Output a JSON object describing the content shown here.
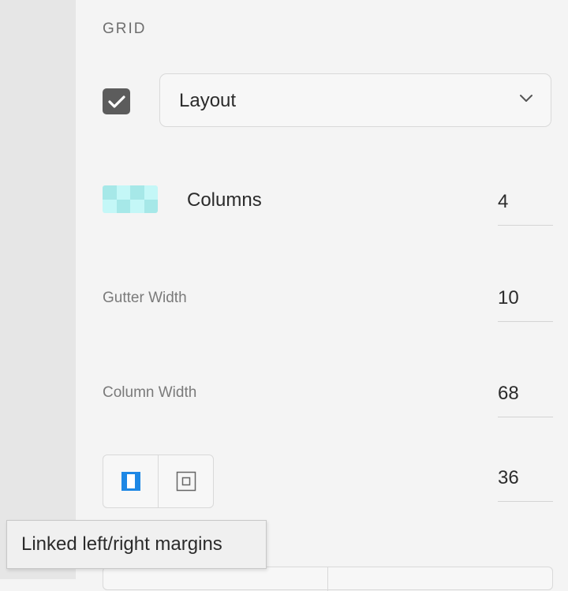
{
  "grid_section": {
    "title": "GRID",
    "layout_checkbox": {
      "checked": true
    },
    "layout_dropdown": {
      "selected": "Layout"
    },
    "columns": {
      "label": "Columns",
      "value": "4"
    },
    "gutter_width": {
      "label": "Gutter Width",
      "value": "10"
    },
    "column_width": {
      "label": "Column Width",
      "value": "68"
    },
    "margins": {
      "value": "36",
      "active_mode": "linked"
    }
  },
  "tooltip": {
    "text": "Linked left/right margins"
  },
  "colors": {
    "accent": "#1e88e5",
    "checkbox_fill": "#5c5c5c",
    "grid_swatch_light": "#c4f7f7",
    "grid_swatch_dark": "#a6e8e8"
  },
  "icons": {
    "checkbox": "checkmark-icon",
    "dropdown": "chevron-down-icon",
    "linked_margins": "linked-margins-icon",
    "unlinked_margins": "unlinked-margins-icon"
  }
}
